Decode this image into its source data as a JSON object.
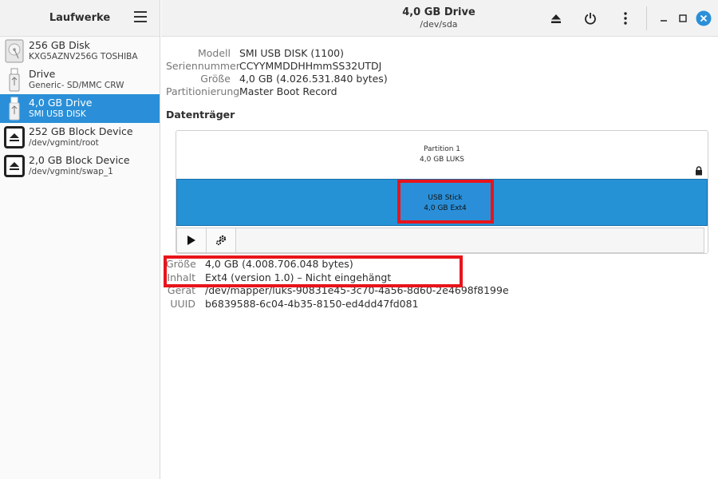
{
  "sidebar": {
    "title": "Laufwerke",
    "items": [
      {
        "name": "256 GB Disk",
        "sub": "KXG5AZNV256G TOSHIBA",
        "icon": "hard-disk-icon",
        "selected": false
      },
      {
        "name": "Drive",
        "sub": "Generic- SD/MMC CRW",
        "icon": "usb-stick-icon",
        "selected": false
      },
      {
        "name": "4,0 GB Drive",
        "sub": "SMI USB DISK",
        "icon": "usb-stick-icon",
        "selected": true
      },
      {
        "name": "252 GB Block Device",
        "sub": "/dev/vgmint/root",
        "icon": "eject-icon",
        "selected": false
      },
      {
        "name": "2,0 GB Block Device",
        "sub": "/dev/vgmint/swap_1",
        "icon": "eject-icon",
        "selected": false
      }
    ]
  },
  "header": {
    "title": "4,0 GB Drive",
    "subtitle": "/dev/sda"
  },
  "drive_props": [
    {
      "label": "Modell",
      "value": "SMI USB DISK (1100)"
    },
    {
      "label": "Seriennummer",
      "value": "CCYYMMDDHHmmSS32UTDJ"
    },
    {
      "label": "Größe",
      "value": "4,0 GB (4.026.531.840 bytes)"
    },
    {
      "label": "Partitionierung",
      "value": "Master Boot Record"
    }
  ],
  "volumes": {
    "title": "Datenträger",
    "outer": {
      "line1": "Partition 1",
      "line2": "4,0 GB LUKS"
    },
    "inner": {
      "line1": "USB Stick",
      "line2": "4,0 GB Ext4"
    }
  },
  "details": [
    {
      "label": "Größe",
      "value": "4,0 GB (4.008.706.048 bytes)"
    },
    {
      "label": "Inhalt",
      "value": "Ext4 (version 1.0) – Nicht eingehängt"
    },
    {
      "label": "Gerät",
      "value": "/dev/mapper/luks-90831e45-3c70-4a56-8d60-2e4698f8199e"
    },
    {
      "label": "UUID",
      "value": "b6839588-6c04-4b35-8150-ed4dd47fd081"
    }
  ],
  "colors": {
    "accent": "#2a8fd8",
    "highlight": "#e8141b",
    "close": "#2a8fd8"
  }
}
